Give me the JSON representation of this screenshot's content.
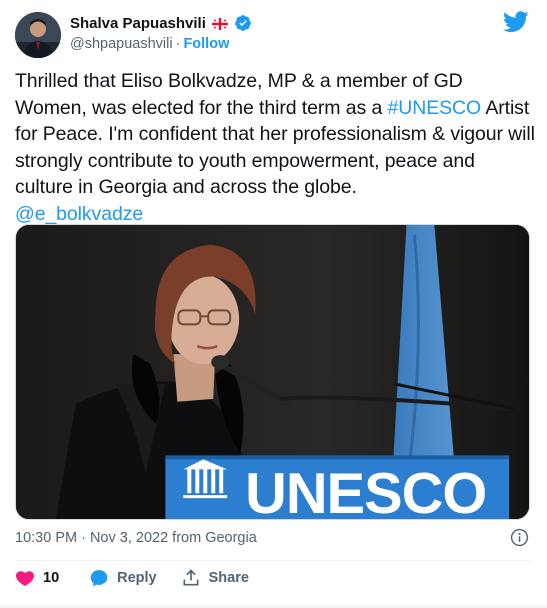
{
  "author": {
    "display_name": "Shalva Papuashvili",
    "handle": "@shpapuashvili",
    "separator": "·",
    "follow_label": "Follow",
    "flag_icon": "georgia-flag-icon",
    "verified_icon": "verified-badge-icon"
  },
  "brand": {
    "logo_icon": "twitter-bird-icon",
    "color": "#1d9bf0"
  },
  "tweet": {
    "text_part1": "Thrilled that Eliso Bolkvadze, MP & a member of GD Women, was elected for the third term as a ",
    "hashtag": "#UNESCO",
    "text_part2": " Artist for Peace. I'm confident that her professionalism & vigour will strongly contribute to youth empowerment, peace and culture in Georgia and across the globe.",
    "mention": "@e_bolkvadze"
  },
  "photo": {
    "sign_text": "UNESCO",
    "description_icon": "photo"
  },
  "meta": {
    "timestamp": "10:30 PM · Nov 3, 2022 from Georgia",
    "info_icon": "info-icon"
  },
  "actions": {
    "like_count": "10",
    "reply_label": "Reply",
    "share_label": "Share"
  },
  "colors": {
    "like": "#f91880",
    "reply": "#1d9bf0",
    "text_secondary": "#536471"
  }
}
